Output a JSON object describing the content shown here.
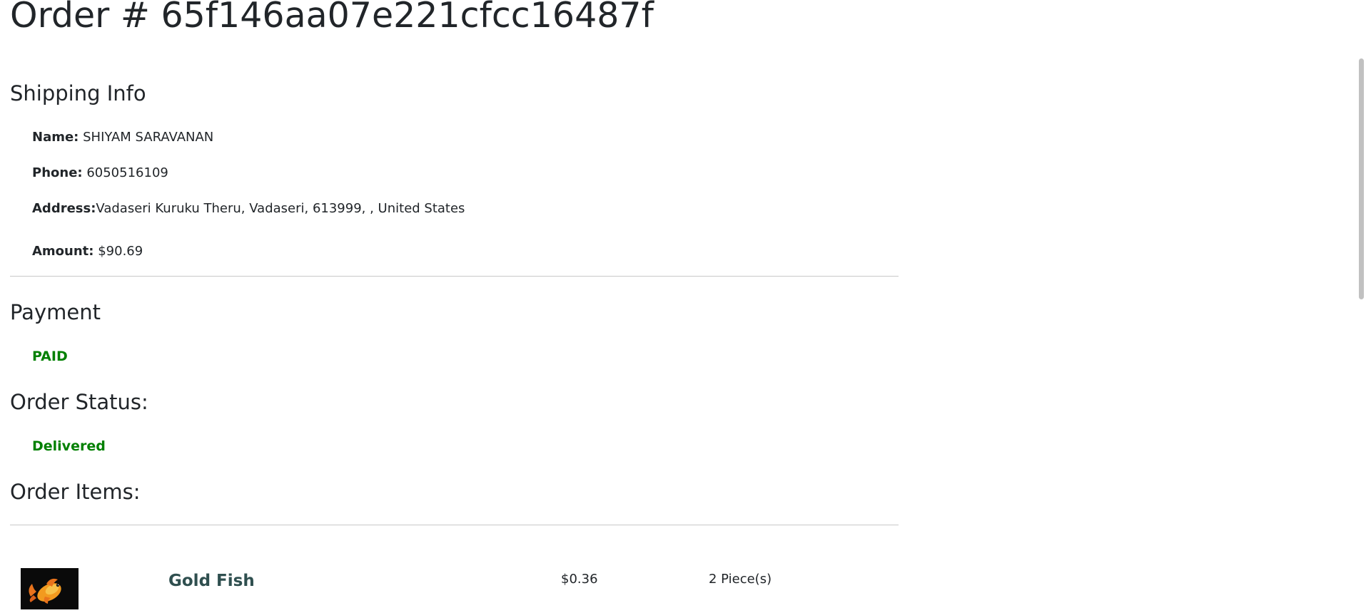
{
  "order": {
    "title": "Order # 65f146aa07e221cfcc16487f"
  },
  "shipping": {
    "heading": "Shipping Info",
    "name_label": "Name:",
    "name_value": "SHIYAM SARAVANAN",
    "phone_label": "Phone:",
    "phone_value": "6050516109",
    "address_label": "Address:",
    "address_value": "Vadaseri Kuruku Theru, Vadaseri, 613999, , United States",
    "amount_label": "Amount:",
    "amount_value": "$90.69"
  },
  "payment": {
    "heading": "Payment",
    "status": "PAID",
    "status_color": "#008000"
  },
  "order_status": {
    "heading": "Order Status:",
    "status": "Delivered",
    "status_color": "#008000"
  },
  "order_items": {
    "heading": "Order Items:",
    "items": [
      {
        "name": "Gold Fish",
        "price": "$0.36",
        "quantity": "2 Piece(s)",
        "image_icon": "goldfish-image"
      }
    ]
  }
}
